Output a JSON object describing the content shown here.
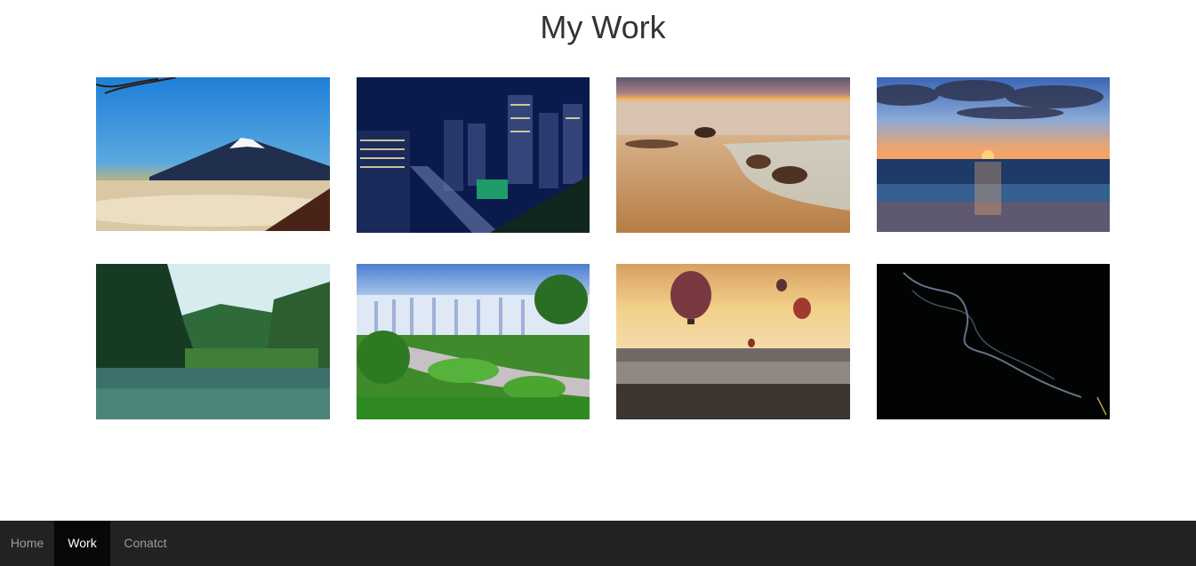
{
  "page": {
    "title": "My Work"
  },
  "gallery": {
    "items": [
      {
        "subject": "mountain-fuji"
      },
      {
        "subject": "city-night"
      },
      {
        "subject": "beach-sunset-rocks"
      },
      {
        "subject": "ocean-sunset"
      },
      {
        "subject": "river-jungle"
      },
      {
        "subject": "waterfall"
      },
      {
        "subject": "hot-air-balloons"
      },
      {
        "subject": "smoke-dark"
      }
    ]
  },
  "navbar": {
    "items": [
      {
        "label": "Home",
        "active": false
      },
      {
        "label": "Work",
        "active": true
      },
      {
        "label": "Conatct",
        "active": false
      }
    ]
  },
  "colors": {
    "navbar_bg": "#222222",
    "navbar_active_bg": "#080808",
    "navbar_text": "#9d9d9d",
    "navbar_active_text": "#ffffff",
    "title_text": "#333333"
  }
}
